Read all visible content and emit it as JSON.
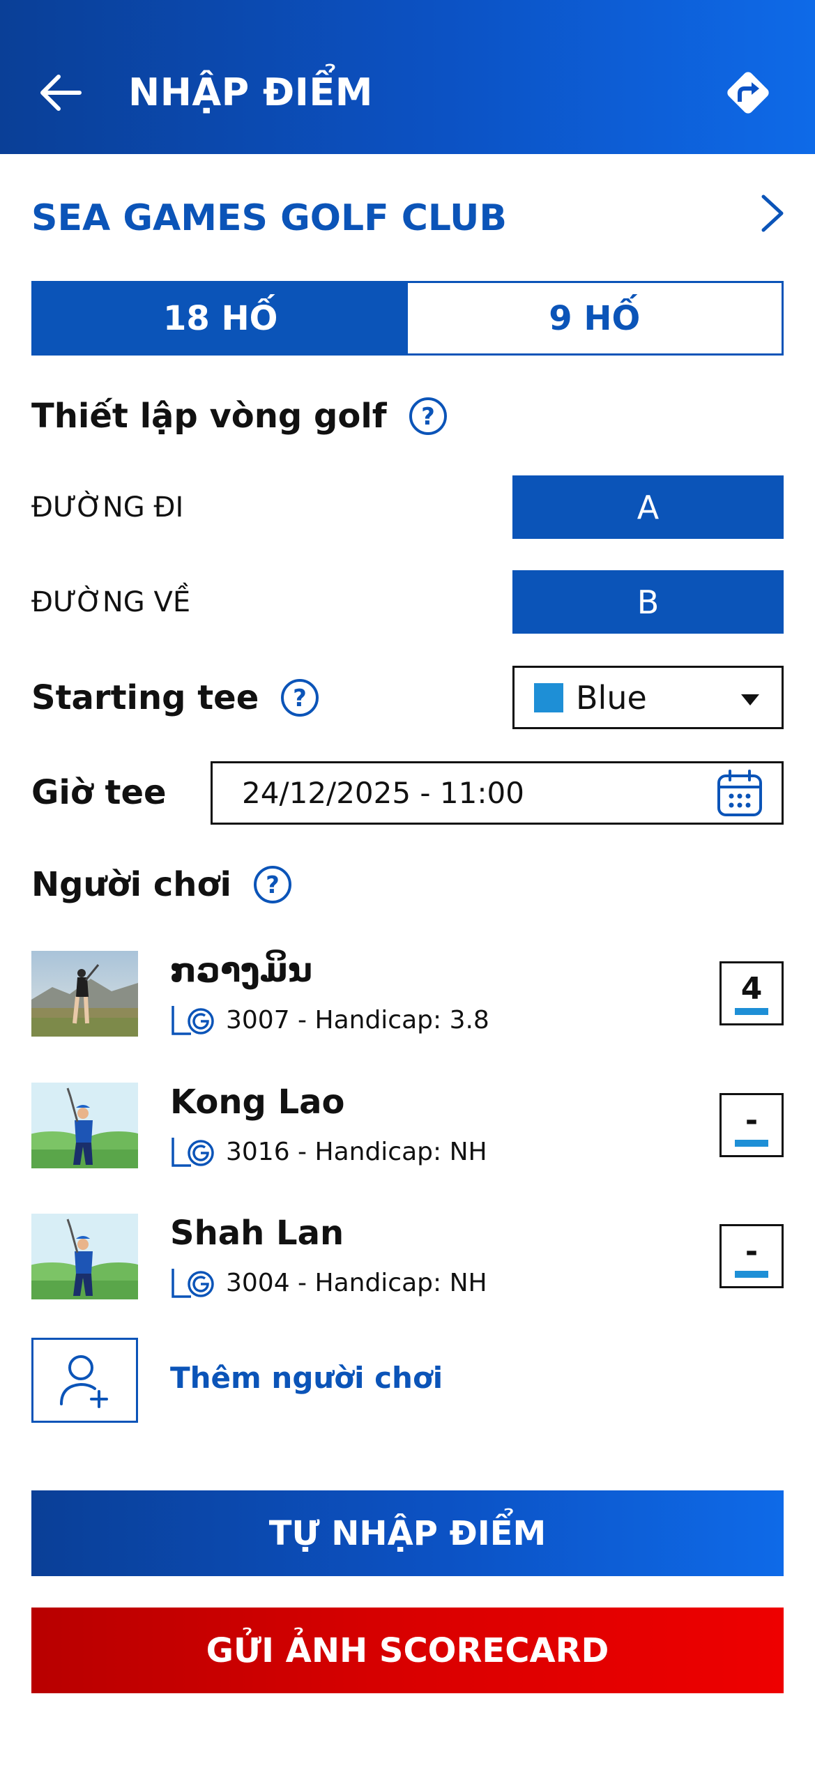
{
  "header": {
    "title": "NHẬP ĐIỂM",
    "back_icon": "arrow-left-icon",
    "share_icon": "directions-icon"
  },
  "club": {
    "name": "SEA GAMES GOLF CLUB",
    "chevron_icon": "chevron-right-icon"
  },
  "holes": {
    "options": [
      "18 HỐ",
      "9 HỐ"
    ],
    "selected": "18 HỐ"
  },
  "setup": {
    "title": "Thiết lập vòng golf",
    "out_label": "ĐƯỜNG ĐI",
    "out_value": "A",
    "in_label": "ĐƯỜNG VỀ",
    "in_value": "B"
  },
  "tee": {
    "label": "Starting tee",
    "value": "Blue",
    "color": "#1e8fd6"
  },
  "tee_time": {
    "label": "Giờ tee",
    "value": "24/12/2025 - 11:00"
  },
  "players": {
    "title": "Người chơi",
    "list": [
      {
        "name": "ກວາງມິນ",
        "info": "3007 - Handicap: 3.8",
        "score": "4"
      },
      {
        "name": "Kong Lao",
        "info": "3016 - Handicap: NH",
        "score": "-"
      },
      {
        "name": "Shah Lan",
        "info": "3004 - Handicap: NH",
        "score": "-"
      }
    ],
    "add_label": "Thêm người chơi"
  },
  "actions": {
    "manual": "TỰ NHẬP ĐIỂM",
    "photo": "GỬI ẢNH SCORECARD"
  },
  "colors": {
    "brand_blue": "#0b54b8",
    "accent_blue": "#1e8fd6",
    "brand_red": "#d90000"
  }
}
